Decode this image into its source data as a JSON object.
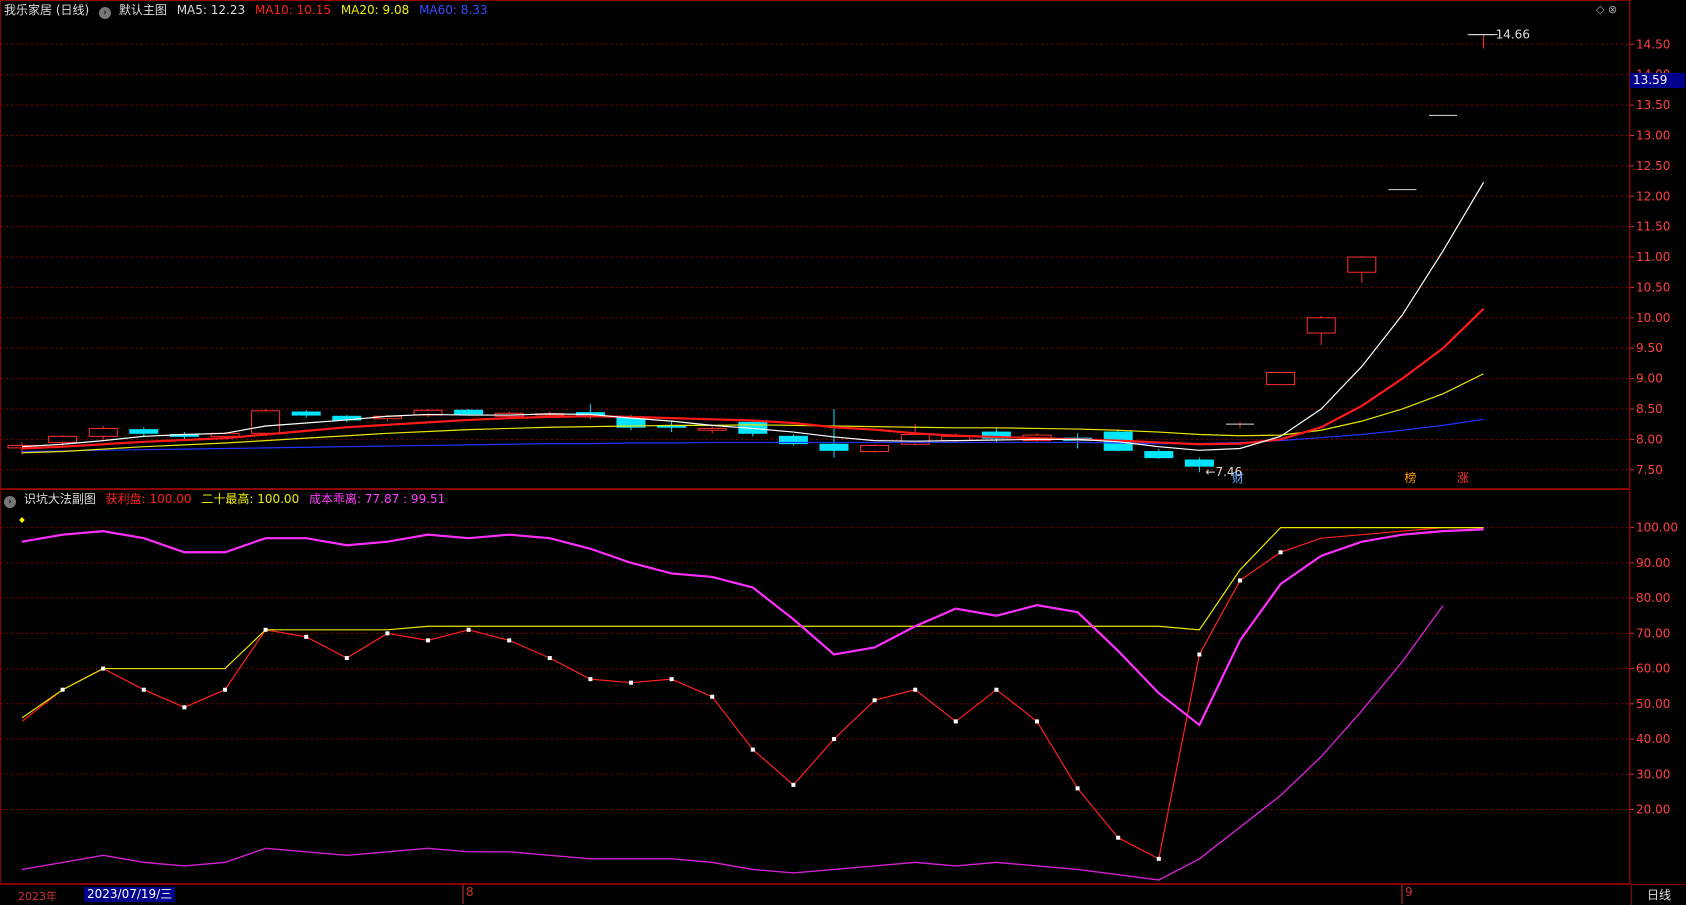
{
  "main_header": {
    "stock": "我乐家居 (日线)",
    "chart_name": "默认主图",
    "ma5": "MA5: 12.23",
    "ma10": "MA10: 10.15",
    "ma20": "MA20: 9.08",
    "ma60": "MA60: 8.33"
  },
  "sub_header": {
    "indicator": "识坑大法副图",
    "profit": "获利盘: 100.00",
    "high20": "二十最高: 100.00",
    "cost": "成本乖离: 77.87 : 99.51"
  },
  "top_right_icons": "◇ ⊗",
  "price_tag": "13.59",
  "bottom": {
    "year": "2023年",
    "date": "2023/07/19/三",
    "period": "日线"
  },
  "colors": {
    "up": "#ff3030",
    "down": "#00e5ff",
    "ma5": "#ffffff",
    "ma10": "#ff1a1a",
    "ma20": "#e6e600",
    "ma60": "#2233ff",
    "profit": "#ff2020",
    "high20": "#e6e600",
    "cost1": "#ff30ff",
    "cost2": "#d020d0",
    "grid": "#8b0000"
  },
  "chart_data": [
    {
      "type": "candlestick",
      "y_ticks": [
        "14.50",
        "14.00",
        "13.50",
        "13.00",
        "12.50",
        "12.00",
        "11.50",
        "11.00",
        "10.50",
        "10.00",
        "9.50",
        "9.00",
        "8.50",
        "8.00",
        "7.50"
      ],
      "ylim": [
        7.2,
        14.9
      ],
      "candles": [
        {
          "o": 7.86,
          "h": 7.95,
          "l": 7.75,
          "c": 7.9
        },
        {
          "o": 7.95,
          "h": 8.07,
          "l": 7.9,
          "c": 8.05
        },
        {
          "o": 8.05,
          "h": 8.22,
          "l": 8.0,
          "c": 8.18
        },
        {
          "o": 8.16,
          "h": 8.2,
          "l": 8.05,
          "c": 8.1
        },
        {
          "o": 8.08,
          "h": 8.12,
          "l": 8.0,
          "c": 8.05
        },
        {
          "o": 8.05,
          "h": 8.12,
          "l": 8.02,
          "c": 8.1
        },
        {
          "o": 8.1,
          "h": 8.5,
          "l": 8.05,
          "c": 8.47
        },
        {
          "o": 8.45,
          "h": 8.48,
          "l": 8.36,
          "c": 8.4
        },
        {
          "o": 8.38,
          "h": 8.4,
          "l": 8.28,
          "c": 8.32
        },
        {
          "o": 8.34,
          "h": 8.4,
          "l": 8.3,
          "c": 8.38
        },
        {
          "o": 8.4,
          "h": 8.5,
          "l": 8.36,
          "c": 8.48
        },
        {
          "o": 8.48,
          "h": 8.5,
          "l": 8.4,
          "c": 8.42
        },
        {
          "o": 8.38,
          "h": 8.46,
          "l": 8.36,
          "c": 8.43
        },
        {
          "o": 8.4,
          "h": 8.46,
          "l": 8.36,
          "c": 8.42
        },
        {
          "o": 8.44,
          "h": 8.58,
          "l": 8.34,
          "c": 8.37
        },
        {
          "o": 8.37,
          "h": 8.4,
          "l": 8.15,
          "c": 8.2
        },
        {
          "o": 8.22,
          "h": 8.3,
          "l": 8.12,
          "c": 8.2
        },
        {
          "o": 8.15,
          "h": 8.22,
          "l": 8.1,
          "c": 8.18
        },
        {
          "o": 8.28,
          "h": 8.3,
          "l": 8.05,
          "c": 8.1
        },
        {
          "o": 8.05,
          "h": 8.08,
          "l": 7.9,
          "c": 7.93
        },
        {
          "o": 7.92,
          "h": 8.5,
          "l": 7.7,
          "c": 7.82
        },
        {
          "o": 7.8,
          "h": 7.92,
          "l": 7.78,
          "c": 7.9
        },
        {
          "o": 7.92,
          "h": 8.25,
          "l": 7.9,
          "c": 8.08
        },
        {
          "o": 7.98,
          "h": 8.1,
          "l": 7.95,
          "c": 8.05
        },
        {
          "o": 8.12,
          "h": 8.2,
          "l": 7.95,
          "c": 8.02
        },
        {
          "o": 7.98,
          "h": 8.1,
          "l": 7.95,
          "c": 8.07
        },
        {
          "o": 8.02,
          "h": 8.1,
          "l": 7.85,
          "c": 7.98
        },
        {
          "o": 8.12,
          "h": 8.15,
          "l": 7.8,
          "c": 7.82
        },
        {
          "o": 7.8,
          "h": 7.84,
          "l": 7.68,
          "c": 7.7
        },
        {
          "o": 7.66,
          "h": 7.7,
          "l": 7.46,
          "c": 7.56
        },
        {
          "o": 8.25,
          "h": 8.28,
          "l": 8.18,
          "c": 8.25
        },
        {
          "o": 8.9,
          "h": 9.1,
          "l": 8.9,
          "c": 9.1
        },
        {
          "o": 9.75,
          "h": 10.03,
          "l": 9.55,
          "c": 10.0
        },
        {
          "o": 10.75,
          "h": 11.02,
          "l": 10.58,
          "c": 11.0
        },
        {
          "o": 12.11,
          "h": 12.11,
          "l": 12.11,
          "c": 12.11
        },
        {
          "o": 13.33,
          "h": 13.33,
          "l": 13.33,
          "c": 13.33
        },
        {
          "o": 14.66,
          "h": 14.66,
          "l": 14.43,
          "c": 14.66
        }
      ],
      "ma5": [
        7.88,
        7.92,
        7.98,
        8.05,
        8.08,
        8.1,
        8.22,
        8.27,
        8.32,
        8.38,
        8.41,
        8.4,
        8.4,
        8.42,
        8.41,
        8.35,
        8.3,
        8.23,
        8.18,
        8.12,
        8.04,
        7.98,
        7.97,
        7.98,
        7.99,
        8.0,
        8.0,
        7.96,
        7.88,
        7.82,
        7.85,
        8.05,
        8.5,
        9.2,
        10.05,
        11.1,
        12.23
      ],
      "ma10": [
        7.85,
        7.88,
        7.92,
        7.96,
        7.99,
        8.02,
        8.08,
        8.14,
        8.2,
        8.24,
        8.28,
        8.32,
        8.35,
        8.37,
        8.38,
        8.37,
        8.35,
        8.33,
        8.31,
        8.27,
        8.2,
        8.16,
        8.1,
        8.06,
        8.04,
        8.02,
        8.0,
        7.98,
        7.95,
        7.92,
        7.93,
        8.0,
        8.2,
        8.55,
        9.0,
        9.5,
        10.15
      ],
      "ma20": [
        7.78,
        7.8,
        7.84,
        7.88,
        7.91,
        7.94,
        7.98,
        8.02,
        8.06,
        8.1,
        8.13,
        8.16,
        8.18,
        8.2,
        8.21,
        8.22,
        8.23,
        8.23,
        8.24,
        8.23,
        8.22,
        8.21,
        8.2,
        8.19,
        8.19,
        8.18,
        8.17,
        8.15,
        8.12,
        8.08,
        8.06,
        8.07,
        8.15,
        8.3,
        8.5,
        8.75,
        9.08
      ],
      "ma60": [
        7.8,
        7.81,
        7.82,
        7.83,
        7.84,
        7.85,
        7.86,
        7.87,
        7.88,
        7.89,
        7.9,
        7.91,
        7.92,
        7.93,
        7.93,
        7.94,
        7.94,
        7.95,
        7.95,
        7.95,
        7.95,
        7.95,
        7.95,
        7.95,
        7.95,
        7.95,
        7.95,
        7.94,
        7.93,
        7.93,
        7.95,
        7.98,
        8.03,
        8.08,
        8.15,
        8.23,
        8.33
      ],
      "labels": {
        "high": "14.66",
        "low": "←7.46",
        "tag1": "财",
        "tag2": "榜",
        "tag3": "涨"
      }
    },
    {
      "type": "line",
      "y_ticks": [
        "100.00",
        "90.00",
        "80.00",
        "70.00",
        "60.00",
        "50.00",
        "40.00",
        "30.00",
        "20.00"
      ],
      "ylim": [
        0,
        105
      ],
      "series": [
        {
          "key": "profit",
          "values": [
            45,
            54,
            60,
            54,
            49,
            54,
            71,
            69,
            63,
            70,
            68,
            71,
            68,
            63,
            57,
            56,
            57,
            52,
            37,
            27,
            40,
            51,
            54,
            45,
            54,
            45,
            26,
            12,
            6,
            64,
            85,
            93,
            97,
            98,
            99,
            100,
            100
          ]
        },
        {
          "key": "high20",
          "values": [
            46,
            54,
            60,
            60,
            60,
            60,
            71,
            71,
            71,
            71,
            72,
            72,
            72,
            72,
            72,
            72,
            72,
            72,
            72,
            72,
            72,
            72,
            72,
            72,
            72,
            72,
            72,
            72,
            72,
            71,
            88,
            100,
            100,
            100,
            100,
            100,
            100
          ]
        },
        {
          "key": "cost1",
          "values": [
            96,
            98,
            99,
            97,
            93,
            93,
            97,
            97,
            95,
            96,
            98,
            97,
            98,
            97,
            94,
            90,
            87,
            86,
            83,
            74,
            64,
            66,
            72,
            77,
            75,
            78,
            76,
            65,
            53,
            44,
            68,
            84,
            92,
            96,
            98,
            99,
            99.51
          ]
        },
        {
          "key": "cost2",
          "values": [
            3,
            5,
            7,
            5,
            4,
            5,
            9,
            8,
            7,
            8,
            9,
            8,
            8,
            7,
            6,
            6,
            6,
            5,
            3,
            2,
            3,
            4,
            5,
            4,
            5,
            4,
            3,
            1.5,
            0,
            6,
            15,
            24,
            35,
            48,
            62,
            77.87
          ]
        }
      ]
    }
  ]
}
